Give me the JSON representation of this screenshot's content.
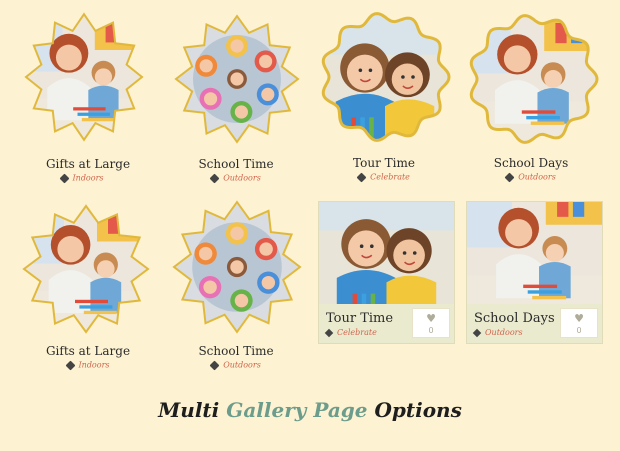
{
  "gallery": {
    "items": [
      {
        "title": "Gifts at Large",
        "tag": "Indoors",
        "shape": "starburst",
        "photo": "teacher-child"
      },
      {
        "title": "School Time",
        "tag": "Outdoors",
        "shape": "starburst",
        "photo": "children-circle"
      },
      {
        "title": "Tour Time",
        "tag": "Celebrate",
        "shape": "scalloped",
        "photo": "girls-smiling"
      },
      {
        "title": "School Days",
        "tag": "Outdoors",
        "shape": "scalloped",
        "photo": "teacher-child"
      },
      {
        "title": "Gifts at Large",
        "tag": "Indoors",
        "shape": "starburst",
        "photo": "teacher-child"
      },
      {
        "title": "School Time",
        "tag": "Outdoors",
        "shape": "starburst",
        "photo": "children-circle"
      },
      {
        "title": "Tour Time",
        "tag": "Celebrate",
        "shape": "card",
        "photo": "girls-smiling",
        "likes": "0"
      },
      {
        "title": "School Days",
        "tag": "Outdoors",
        "shape": "card",
        "photo": "teacher-child",
        "likes": "0"
      }
    ]
  },
  "footer": {
    "part1": "Multi",
    "part2": "Gallery Page",
    "part3": "Options"
  },
  "colors": {
    "background": "#fdf2d1",
    "tag": "#d0664e",
    "accent": "#6c9c8c",
    "frame": "#e0b93c"
  },
  "icons": {
    "tag": "tag-icon",
    "like": "heart-icon"
  }
}
